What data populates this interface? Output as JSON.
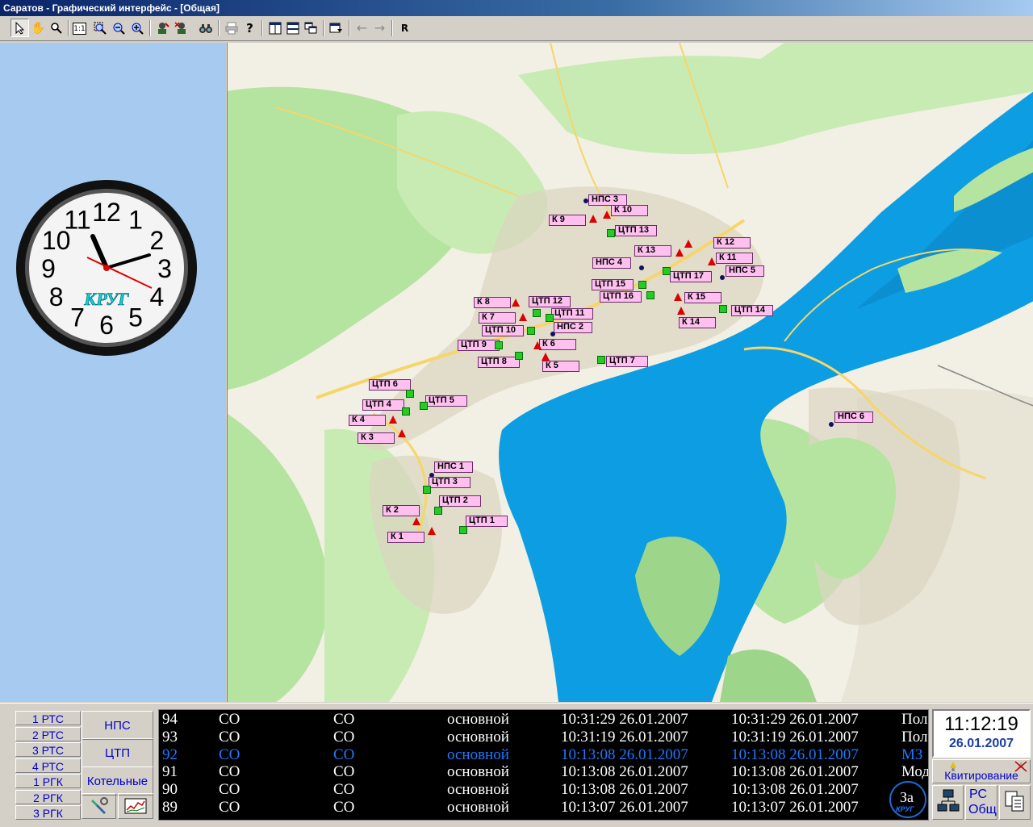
{
  "window": {
    "title": "Саратов - Графический интерфейс - [Общая]"
  },
  "toolbar": {
    "zoom_1to1": "1:1",
    "refresh_label": "R"
  },
  "clock": {
    "brand": "КРУГ",
    "numerals": [
      "12",
      "1",
      "2",
      "3",
      "4",
      "5",
      "6",
      "7",
      "8",
      "9",
      "10",
      "11"
    ]
  },
  "map": {
    "labels": [
      {
        "text": "НПС 3",
        "type": "nps"
      },
      {
        "text": "К 10",
        "type": "k"
      },
      {
        "text": "К 9",
        "type": "k"
      },
      {
        "text": "ЦТП 13",
        "type": "ctp"
      },
      {
        "text": "К 12",
        "type": "k"
      },
      {
        "text": "К 13",
        "type": "k"
      },
      {
        "text": "К 11",
        "type": "k"
      },
      {
        "text": "НПС 4",
        "type": "nps"
      },
      {
        "text": "НПС 5",
        "type": "nps"
      },
      {
        "text": "ЦТП 17",
        "type": "ctp"
      },
      {
        "text": "ЦТП 15",
        "type": "ctp"
      },
      {
        "text": "ЦТП 16",
        "type": "ctp"
      },
      {
        "text": "К 15",
        "type": "k"
      },
      {
        "text": "ЦТП 14",
        "type": "ctp"
      },
      {
        "text": "К 14",
        "type": "k"
      },
      {
        "text": "К 8",
        "type": "k"
      },
      {
        "text": "ЦТП 12",
        "type": "ctp"
      },
      {
        "text": "ЦТП 11",
        "type": "ctp"
      },
      {
        "text": "К 7",
        "type": "k"
      },
      {
        "text": "НПС 2",
        "type": "nps"
      },
      {
        "text": "ЦТП 10",
        "type": "ctp"
      },
      {
        "text": "ЦТП 9",
        "type": "ctp"
      },
      {
        "text": "К 6",
        "type": "k"
      },
      {
        "text": "ЦТП 8",
        "type": "ctp"
      },
      {
        "text": "К 5",
        "type": "k"
      },
      {
        "text": "ЦТП 7",
        "type": "ctp"
      },
      {
        "text": "ЦТП 6",
        "type": "ctp"
      },
      {
        "text": "ЦТП 5",
        "type": "ctp"
      },
      {
        "text": "ЦТП 4",
        "type": "ctp"
      },
      {
        "text": "К 4",
        "type": "k"
      },
      {
        "text": "К 3",
        "type": "k"
      },
      {
        "text": "НПС 6",
        "type": "nps"
      },
      {
        "text": "НПС 1",
        "type": "nps"
      },
      {
        "text": "ЦТП 3",
        "type": "ctp"
      },
      {
        "text": "ЦТП 2",
        "type": "ctp"
      },
      {
        "text": "К 2",
        "type": "k"
      },
      {
        "text": "ЦТП 1",
        "type": "ctp"
      },
      {
        "text": "К 1",
        "type": "k"
      }
    ],
    "colors": {
      "ctp_marker": "#22cc22",
      "k_marker": "#dd0000",
      "nps_marker": "#101060",
      "label_bg": "#ffc0f0",
      "water": "#0d9de3",
      "land": "#f2efe4",
      "green": "#b5e3a0"
    }
  },
  "nav": [
    "1 РТС",
    "2 РТС",
    "3 РТС",
    "4 РТС",
    "1 РГК",
    "2 РГК",
    "3 РГК"
  ],
  "categories": [
    "НПС",
    "ЦТП",
    "Котельные"
  ],
  "log": {
    "rows": [
      {
        "id": "94",
        "c1": "СО",
        "c2": "СО",
        "mode": "основной",
        "t1": "10:31:29 26.01.2007",
        "t2": "10:31:29 26.01.2007",
        "extra": "Пол"
      },
      {
        "id": "93",
        "c1": "СО",
        "c2": "СО",
        "mode": "основной",
        "t1": "10:31:19 26.01.2007",
        "t2": "10:31:19 26.01.2007",
        "extra": "Пол"
      },
      {
        "id": "92",
        "c1": "СО",
        "c2": "СО",
        "mode": "основной",
        "t1": "10:13:08 26.01.2007",
        "t2": "10:13:08 26.01.2007",
        "extra": "МЗ"
      },
      {
        "id": "91",
        "c1": "СО",
        "c2": "СО",
        "mode": "основной",
        "t1": "10:13:08 26.01.2007",
        "t2": "10:13:08 26.01.2007",
        "extra": "Мод"
      },
      {
        "id": "90",
        "c1": "СО",
        "c2": "СО",
        "mode": "основной",
        "t1": "10:13:08 26.01.2007",
        "t2": "10:13:08 26.01.2007",
        "extra": ""
      },
      {
        "id": "89",
        "c1": "СО",
        "c2": "СО",
        "mode": "основной",
        "t1": "10:13:07 26.01.2007",
        "t2": "10:13:07 26.01.2007",
        "extra": ""
      }
    ],
    "overlay_text": "За",
    "overlay_brand": "КРУГ",
    "selected_color": "#1e78ff"
  },
  "status": {
    "time": "11:12:19",
    "date": "26.01.2007",
    "ack_label": "Квитирование",
    "rs_label": "РС",
    "rs_sub": "Общ"
  }
}
